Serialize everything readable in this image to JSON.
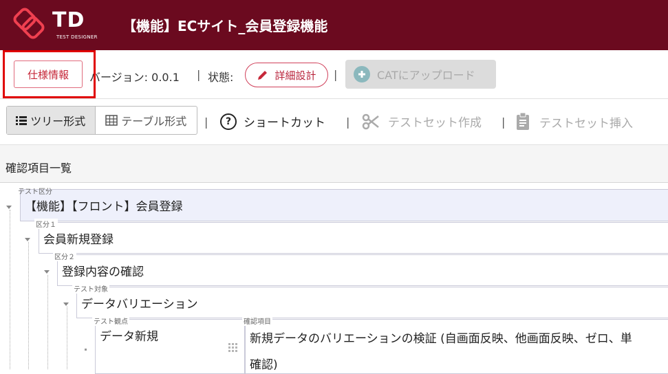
{
  "header": {
    "logo_text": "TD",
    "logo_subtext": "TEST DESIGNER",
    "title": "【機能】ECサイト_会員登録機能"
  },
  "toolbar": {
    "spec_button": "仕様情報",
    "version": "バージョン: 0.0.1",
    "separator": "|",
    "state_label": "状態:",
    "state_button": "詳細設計",
    "upload_button": "CATにアップロード"
  },
  "toolbar2": {
    "tree_view": "ツリー形式",
    "table_view": "テーブル形式",
    "shortcut": "ショートカット",
    "testset_create": "テストセット作成",
    "testset_insert": "テストセット挿入"
  },
  "list": {
    "title": "確認項目一覧"
  },
  "tree": {
    "level0": {
      "tag": "テスト区分",
      "label": "【機能】【フロント】会員登録"
    },
    "level1": {
      "tag": "区分１",
      "label": "会員新規登録"
    },
    "level2": {
      "tag": "区分２",
      "label": "登録内容の確認"
    },
    "level3": {
      "tag": "テスト対象",
      "label": "データバリエーション"
    },
    "viewpoint": {
      "tag": "テスト観点",
      "label": "データ新規"
    },
    "check_item": {
      "tag": "確認項目",
      "line1": "新規データのバリエーションの検証 (自画面反映、他画面反映、ゼロ、単",
      "line2": "確認)"
    }
  },
  "colors": {
    "header_bg": "#6b0a1f",
    "accent_red": "#c62839",
    "highlight": "#e00000"
  },
  "icons": [
    "td-logo-icon",
    "pencil-icon",
    "plus-circle-icon",
    "list-icon",
    "table-icon",
    "question-icon",
    "scissors-icon",
    "clipboard-icon",
    "caret-down-icon",
    "grid-icon"
  ]
}
